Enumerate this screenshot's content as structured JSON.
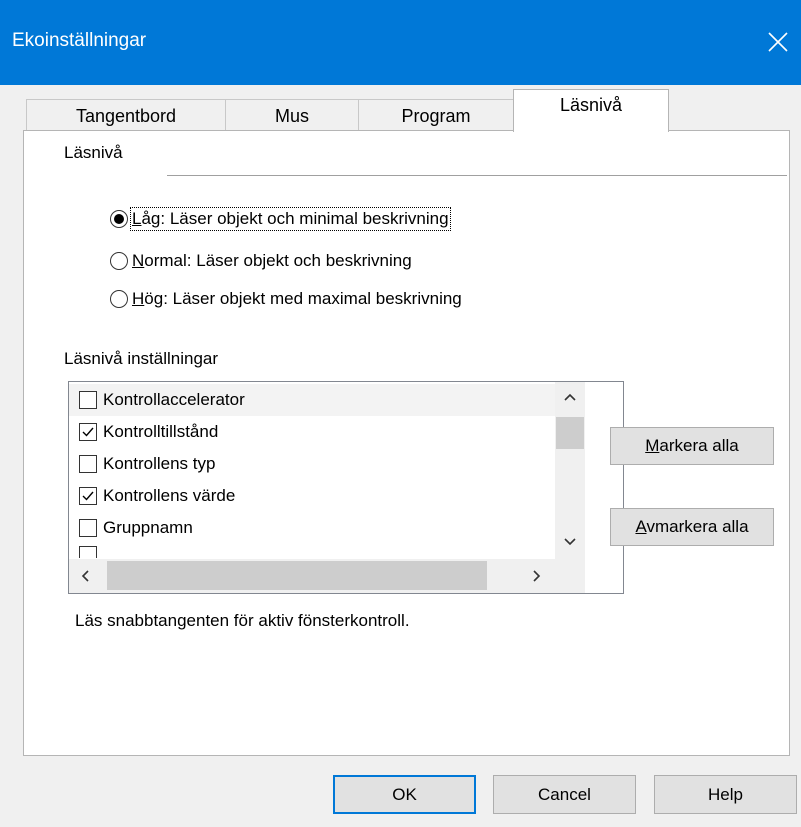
{
  "window": {
    "title": "Ekoinställningar"
  },
  "tabs": [
    {
      "label": "Tangentbord",
      "active": false
    },
    {
      "label": "Mus",
      "active": false
    },
    {
      "label": "Program",
      "active": false
    },
    {
      "label": "Läsnivå",
      "active": true
    }
  ],
  "reading_level": {
    "group_label": "Läsnivå",
    "options": [
      {
        "accel": "L",
        "rest": "åg: Läser objekt och minimal beskrivning",
        "checked": true
      },
      {
        "accel": "N",
        "rest": "ormal: Läser objekt och beskrivning",
        "checked": false
      },
      {
        "accel": "H",
        "rest": "ög: Läser objekt med maximal beskrivning",
        "checked": false
      }
    ]
  },
  "settings": {
    "label": "Läsnivå inställningar",
    "items": [
      {
        "label": "Kontrollaccelerator",
        "checked": false
      },
      {
        "label": "Kontrolltillstånd",
        "checked": true
      },
      {
        "label": "Kontrollens typ",
        "checked": false
      },
      {
        "label": "Kontrollens värde",
        "checked": true
      },
      {
        "label": "Gruppnamn",
        "checked": false
      }
    ],
    "select_all": {
      "accel": "M",
      "rest": "arkera alla"
    },
    "deselect_all": {
      "accel": "A",
      "rest": "vmarkera alla"
    },
    "description": "Läs snabbtangenten för aktiv fönsterkontroll."
  },
  "buttons": {
    "ok": "OK",
    "cancel": "Cancel",
    "help": "Help"
  },
  "colors": {
    "titlebar": "#0078d7",
    "default_button_border": "#0078d7"
  }
}
